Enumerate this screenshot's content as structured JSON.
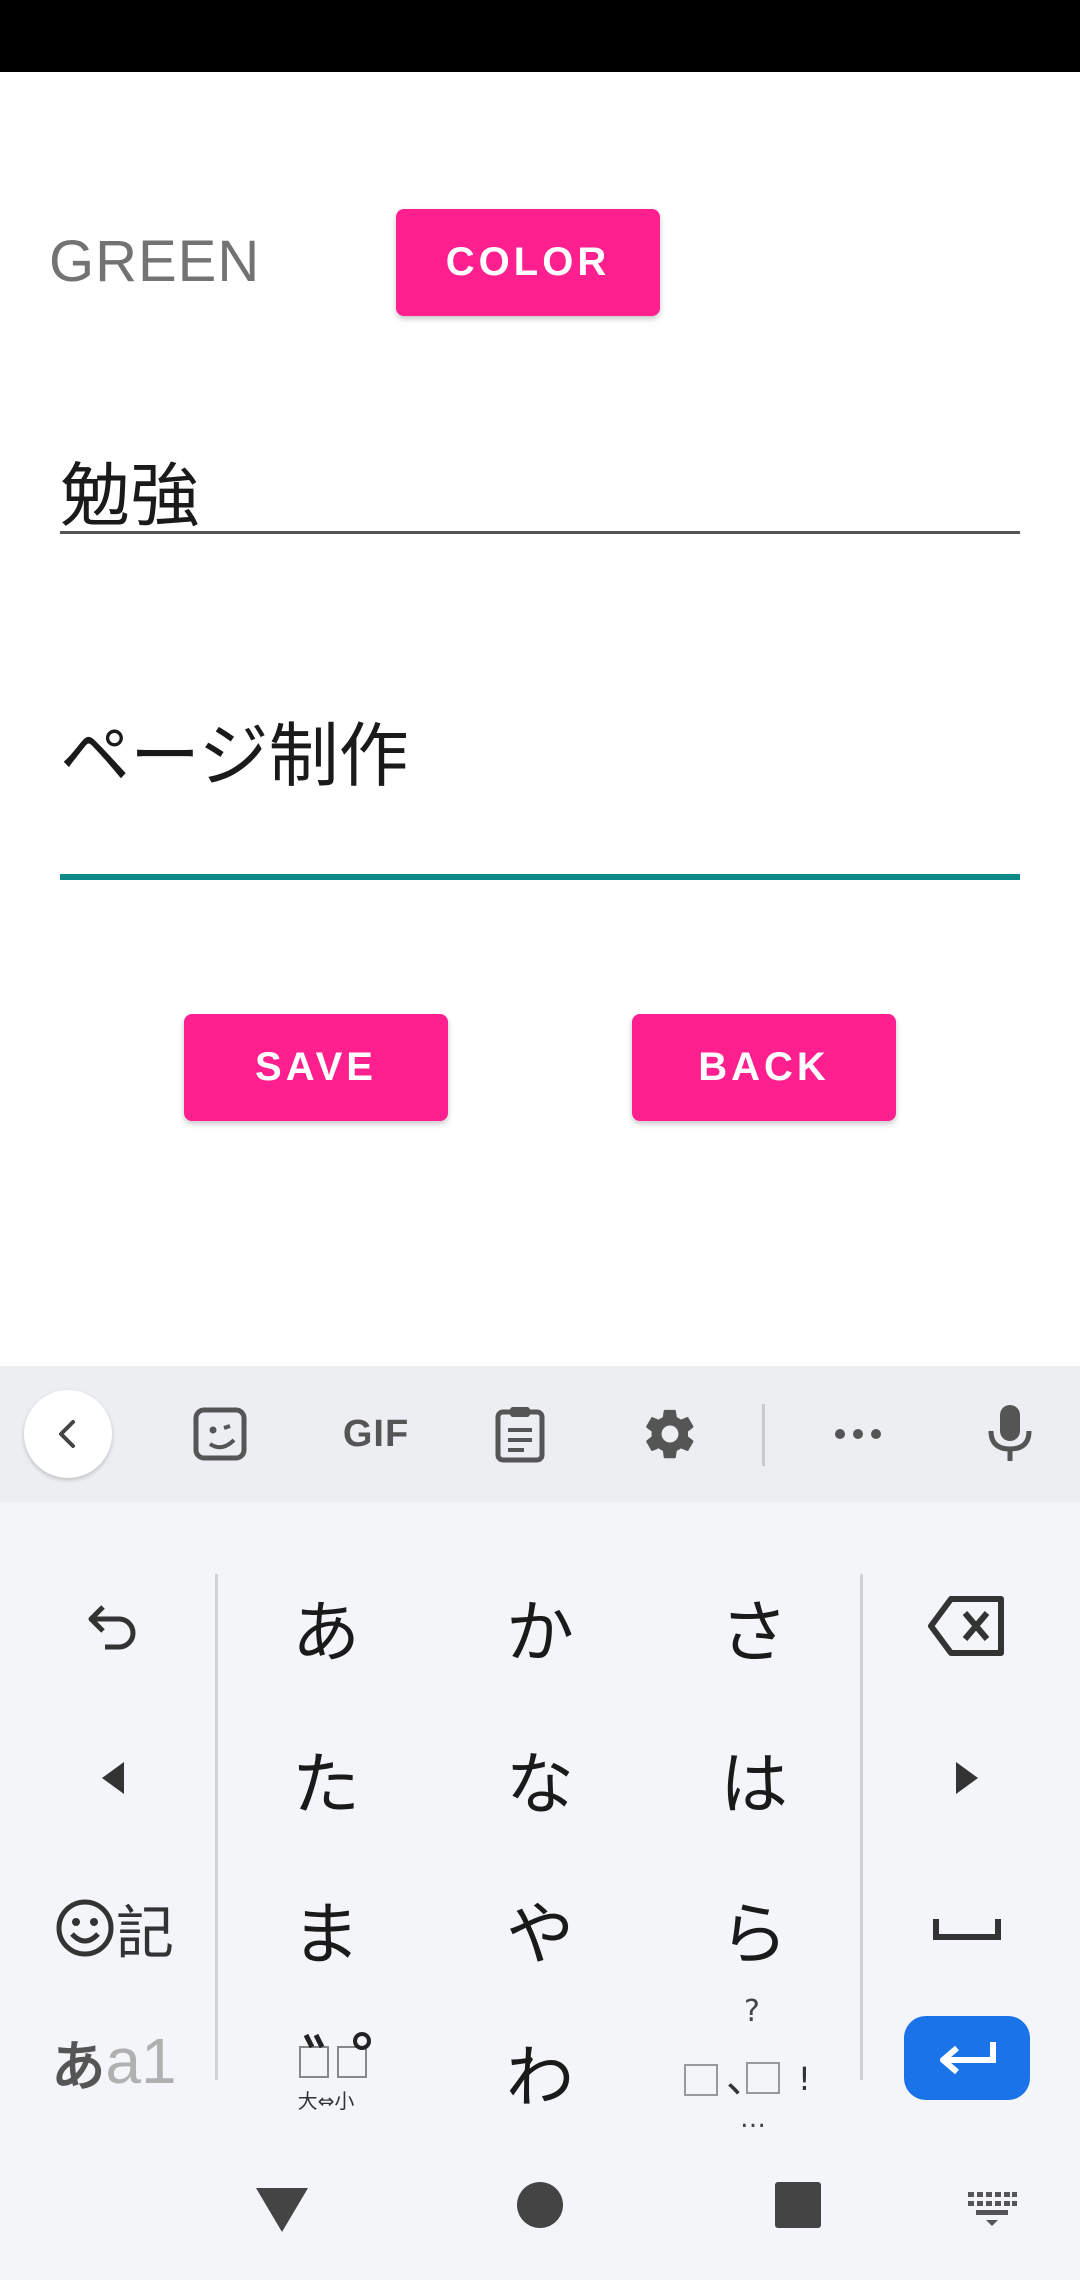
{
  "form": {
    "color_name": "GREEN",
    "color_button": "COLOR",
    "title_value": "勉強",
    "body_value": "ページ制作",
    "save_button": "SAVE",
    "back_button": "BACK"
  },
  "keyboard": {
    "toolbar": {
      "gif_label": "GIF",
      "icons": [
        "back-chevron-icon",
        "sticker-icon",
        "gif-icon",
        "clipboard-icon",
        "settings-icon",
        "more-icon",
        "mic-icon"
      ]
    },
    "rows": [
      [
        "あ",
        "か",
        "さ"
      ],
      [
        "た",
        "な",
        "は"
      ],
      [
        "ま",
        "や",
        "ら"
      ],
      [
        "",
        "わ",
        ""
      ]
    ],
    "emoji_label": "記",
    "mode_kana": "あ",
    "mode_alpha": "a1",
    "dakuten_label": "大⇔小",
    "punct_top": "?",
    "punct_mid": "、",
    "punct_right": "!",
    "punct_bottom": "…"
  },
  "colors": {
    "accent_pink": "#ff1f8e",
    "field_underline_active": "#0e8a86",
    "enter_key_blue": "#1a73e8"
  }
}
